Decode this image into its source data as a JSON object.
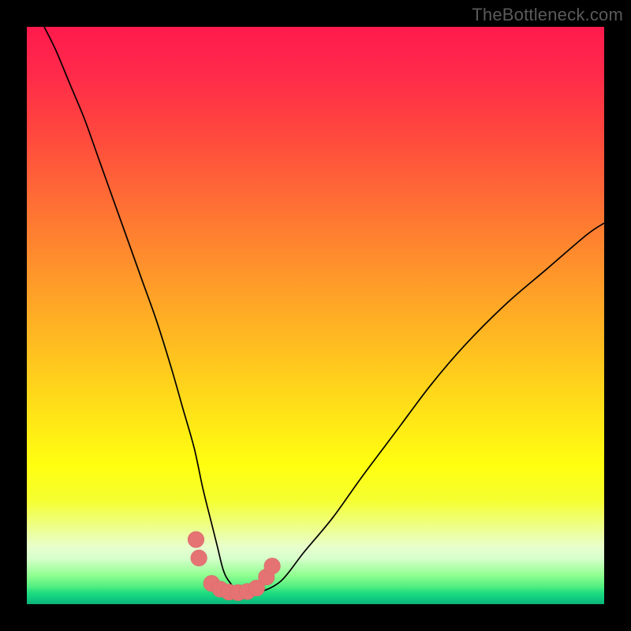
{
  "watermark": "TheBottleneck.com",
  "colors": {
    "marker": "#e57373",
    "curve": "#000000",
    "background_top": "#ff1a4d",
    "background_bottom": "#0db07a"
  },
  "chart_data": {
    "type": "line",
    "title": "",
    "xlabel": "",
    "ylabel": "",
    "xlim": [
      0,
      100
    ],
    "ylim": [
      0,
      100
    ],
    "series": [
      {
        "name": "bottleneck-curve",
        "x": [
          3,
          5,
          7.5,
          10,
          12.5,
          15,
          17.5,
          20,
          22.5,
          25,
          27,
          29,
          30.5,
          32,
          33,
          34,
          35,
          37,
          40,
          44,
          48,
          53,
          58,
          64,
          70,
          76,
          83,
          90,
          97,
          100
        ],
        "y": [
          100,
          96,
          90,
          84,
          77,
          70,
          63,
          56,
          49,
          41,
          34,
          27,
          20,
          14,
          10,
          6,
          4,
          2,
          2,
          4,
          9,
          15,
          22,
          30,
          38,
          45,
          52,
          58,
          64,
          66
        ]
      }
    ],
    "markers": {
      "name": "highlight-markers",
      "points": [
        {
          "x": 29.3,
          "y": 11.2
        },
        {
          "x": 29.8,
          "y": 8.0
        },
        {
          "x": 32.0,
          "y": 3.6
        },
        {
          "x": 33.5,
          "y": 2.6
        },
        {
          "x": 35.0,
          "y": 2.1
        },
        {
          "x": 36.6,
          "y": 2.0
        },
        {
          "x": 38.2,
          "y": 2.2
        },
        {
          "x": 39.8,
          "y": 2.8
        },
        {
          "x": 41.5,
          "y": 4.7
        },
        {
          "x": 42.5,
          "y": 6.6
        }
      ],
      "radius_data_units": 1.4
    }
  }
}
